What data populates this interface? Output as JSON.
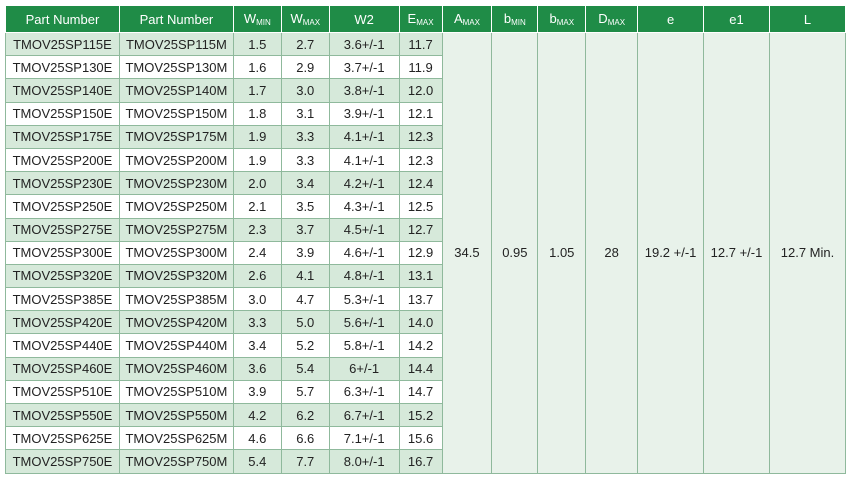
{
  "headers": [
    {
      "main": "Part Number",
      "sub": ""
    },
    {
      "main": "Part Number",
      "sub": ""
    },
    {
      "main": "W",
      "sub": "MIN"
    },
    {
      "main": "W",
      "sub": "MAX"
    },
    {
      "main": "W2",
      "sub": ""
    },
    {
      "main": "E",
      "sub": "MAX"
    },
    {
      "main": "A",
      "sub": "MAX"
    },
    {
      "main": "b",
      "sub": "MIN"
    },
    {
      "main": "b",
      "sub": "MAX"
    },
    {
      "main": "D",
      "sub": "MAX"
    },
    {
      "main": "e",
      "sub": ""
    },
    {
      "main": "e1",
      "sub": ""
    },
    {
      "main": "L",
      "sub": ""
    }
  ],
  "rows": [
    [
      "TMOV25SP115E",
      "TMOV25SP115M",
      "1.5",
      "2.7",
      "3.6+/-1",
      "11.7"
    ],
    [
      "TMOV25SP130E",
      "TMOV25SP130M",
      "1.6",
      "2.9",
      "3.7+/-1",
      "11.9"
    ],
    [
      "TMOV25SP140E",
      "TMOV25SP140M",
      "1.7",
      "3.0",
      "3.8+/-1",
      "12.0"
    ],
    [
      "TMOV25SP150E",
      "TMOV25SP150M",
      "1.8",
      "3.1",
      "3.9+/-1",
      "12.1"
    ],
    [
      "TMOV25SP175E",
      "TMOV25SP175M",
      "1.9",
      "3.3",
      "4.1+/-1",
      "12.3"
    ],
    [
      "TMOV25SP200E",
      "TMOV25SP200M",
      "1.9",
      "3.3",
      "4.1+/-1",
      "12.3"
    ],
    [
      "TMOV25SP230E",
      "TMOV25SP230M",
      "2.0",
      "3.4",
      "4.2+/-1",
      "12.4"
    ],
    [
      "TMOV25SP250E",
      "TMOV25SP250M",
      "2.1",
      "3.5",
      "4.3+/-1",
      "12.5"
    ],
    [
      "TMOV25SP275E",
      "TMOV25SP275M",
      "2.3",
      "3.7",
      "4.5+/-1",
      "12.7"
    ],
    [
      "TMOV25SP300E",
      "TMOV25SP300M",
      "2.4",
      "3.9",
      "4.6+/-1",
      "12.9"
    ],
    [
      "TMOV25SP320E",
      "TMOV25SP320M",
      "2.6",
      "4.1",
      "4.8+/-1",
      "13.1"
    ],
    [
      "TMOV25SP385E",
      "TMOV25SP385M",
      "3.0",
      "4.7",
      "5.3+/-1",
      "13.7"
    ],
    [
      "TMOV25SP420E",
      "TMOV25SP420M",
      "3.3",
      "5.0",
      "5.6+/-1",
      "14.0"
    ],
    [
      "TMOV25SP440E",
      "TMOV25SP440M",
      "3.4",
      "5.2",
      "5.8+/-1",
      "14.2"
    ],
    [
      "TMOV25SP460E",
      "TMOV25SP460M",
      "3.6",
      "5.4",
      "6+/-1",
      "14.4"
    ],
    [
      "TMOV25SP510E",
      "TMOV25SP510M",
      "3.9",
      "5.7",
      "6.3+/-1",
      "14.7"
    ],
    [
      "TMOV25SP550E",
      "TMOV25SP550M",
      "4.2",
      "6.2",
      "6.7+/-1",
      "15.2"
    ],
    [
      "TMOV25SP625E",
      "TMOV25SP625M",
      "4.6",
      "6.6",
      "7.1+/-1",
      "15.6"
    ],
    [
      "TMOV25SP750E",
      "TMOV25SP750M",
      "5.4",
      "7.7",
      "8.0+/-1",
      "16.7"
    ]
  ],
  "common": [
    "34.5",
    "0.95",
    "1.05",
    "28",
    "19.2 +/-1",
    "12.7 +/-1",
    "12.7 Min."
  ],
  "colors": {
    "header_bg": "#1f8c47",
    "row_shade": "#d6e9da",
    "merged_bg": "#e8f2ea"
  }
}
